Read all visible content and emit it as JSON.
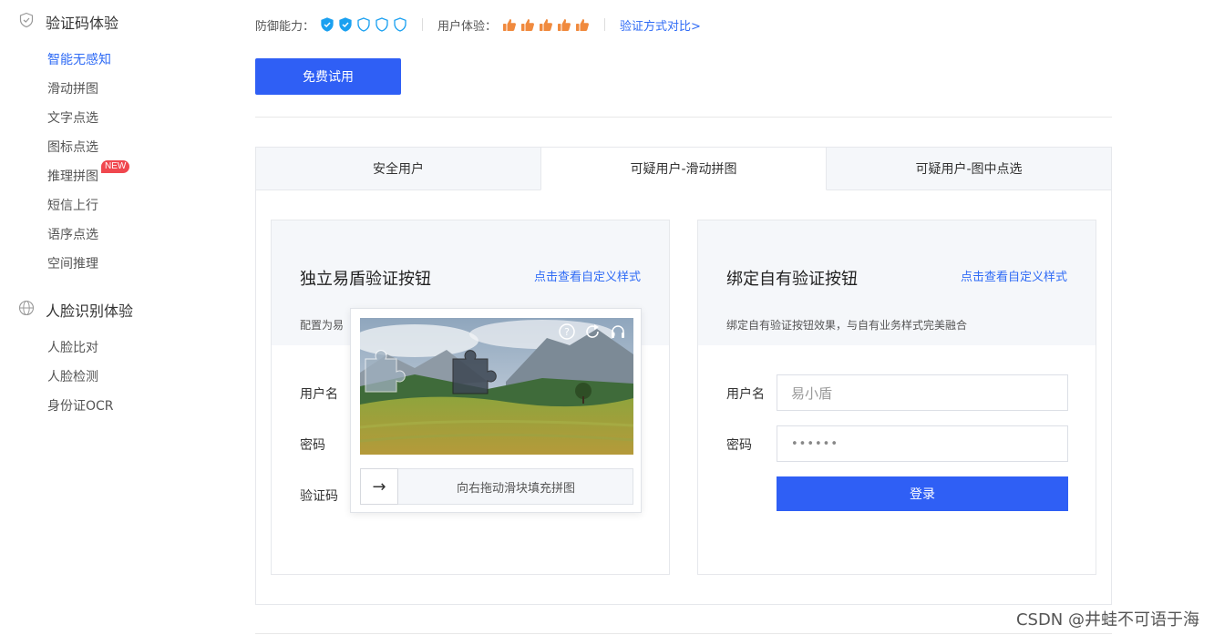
{
  "sidebar": {
    "section1": {
      "title": "验证码体验",
      "icon": "shield-icon"
    },
    "items1": [
      {
        "label": "智能无感知",
        "active": true
      },
      {
        "label": "滑动拼图"
      },
      {
        "label": "文字点选"
      },
      {
        "label": "图标点选"
      },
      {
        "label": "推理拼图",
        "badge": "NEW"
      },
      {
        "label": "短信上行"
      },
      {
        "label": "语序点选"
      },
      {
        "label": "空间推理"
      }
    ],
    "section2": {
      "title": "人脸识别体验",
      "icon": "globe-icon"
    },
    "items2": [
      {
        "label": "人脸比对"
      },
      {
        "label": "人脸检测"
      },
      {
        "label": "身份证OCR"
      }
    ]
  },
  "topbar": {
    "defense_label": "防御能力：",
    "defense_level": 2,
    "defense_max": 5,
    "experience_label": "用户体验：",
    "experience_level": 5,
    "compare_link": "验证方式对比>"
  },
  "trial_button": "免费试用",
  "tabs": [
    {
      "label": "安全用户"
    },
    {
      "label": "可疑用户-滑动拼图",
      "active": true
    },
    {
      "label": "可疑用户-图中点选"
    }
  ],
  "left_card": {
    "title": "独立易盾验证按钮",
    "link": "点击查看自定义样式",
    "desc": "配置为易",
    "username_label": "用户名",
    "password_label": "密码",
    "captcha_label": "验证码"
  },
  "right_card": {
    "title": "绑定自有验证按钮",
    "link": "点击查看自定义样式",
    "desc": "绑定自有验证按钮效果，与自有业务样式完美融合",
    "username_label": "用户名",
    "username_placeholder": "易小盾",
    "password_label": "密码",
    "password_value": "••••••",
    "login_button": "登录"
  },
  "captcha": {
    "slider_text": "向右拖动滑块填充拼图",
    "handle_glyph": "→",
    "tools": [
      "help-icon",
      "refresh-icon",
      "audio-icon"
    ]
  },
  "colors": {
    "accent": "#2f5ff5",
    "link": "#2f6bf5",
    "badge": "#f0474e",
    "thumb": "#f08a3e"
  },
  "watermark": "CSDN @井蛙不可语于海"
}
